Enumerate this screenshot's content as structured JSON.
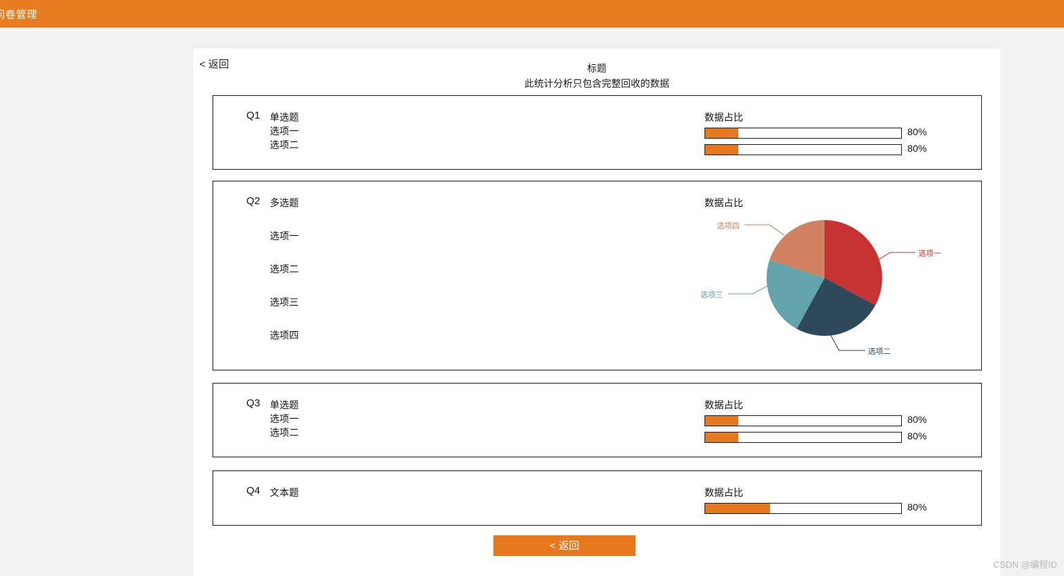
{
  "appbar": {
    "title": "问卷管理",
    "color": "#e77b20"
  },
  "panel": {
    "back_link": "< 返回",
    "doc_title": "标题",
    "doc_subtitle": "此统计分析只包含完整回收的数据",
    "bottom_back_button": "< 返回"
  },
  "stats_heading": "数据占比",
  "watermark": "CSDN @编程ID",
  "colors": {
    "accent": "#e8781e",
    "header": "#e77b20",
    "page_bg": "#f2f2f2",
    "panel_bg": "#ffffff",
    "card_border": "#1a1a1a",
    "pie_red": "#c73333",
    "pie_navy": "#2e4959",
    "pie_teal": "#62a3ac",
    "pie_salmon": "#d0815f"
  },
  "questions": [
    {
      "number": "Q1",
      "type": "单选题",
      "stats_title": "数据占比",
      "options": [
        "选项一",
        "选项二"
      ],
      "bars": [
        {
          "label": "选项一",
          "value": "80%",
          "fill_pct": 17
        },
        {
          "label": "选项二",
          "value": "80%",
          "fill_pct": 17
        }
      ]
    },
    {
      "number": "Q2",
      "type": "多选题",
      "stats_title": "数据占比",
      "options": [
        "选项一",
        "选项二",
        "选项三",
        "选项四"
      ]
    },
    {
      "number": "Q3",
      "type": "单选题",
      "stats_title": "数据占比",
      "options": [
        "选项一",
        "选项二"
      ],
      "bars": [
        {
          "label": "选项一",
          "value": "80%",
          "fill_pct": 17
        },
        {
          "label": "选项二",
          "value": "80%",
          "fill_pct": 17
        }
      ]
    },
    {
      "number": "Q4",
      "type": "文本题",
      "stats_title": "数据占比",
      "options": [],
      "bars": [
        {
          "label": "文本题",
          "value": "80%",
          "fill_pct": 33
        }
      ]
    }
  ],
  "chart_data": {
    "type": "pie",
    "title": "数据占比",
    "labels": [
      "选项一",
      "选项二",
      "选项三",
      "选项四"
    ],
    "values": [
      33,
      25,
      22,
      20
    ],
    "colors": [
      "#c73333",
      "#2e4959",
      "#62a3ac",
      "#d0815f"
    ],
    "label_colors": [
      "#c73333",
      "#2e4959",
      "#62a3ac",
      "#d0815f"
    ],
    "legend": "labels-with-leader-lines",
    "grid": false
  }
}
